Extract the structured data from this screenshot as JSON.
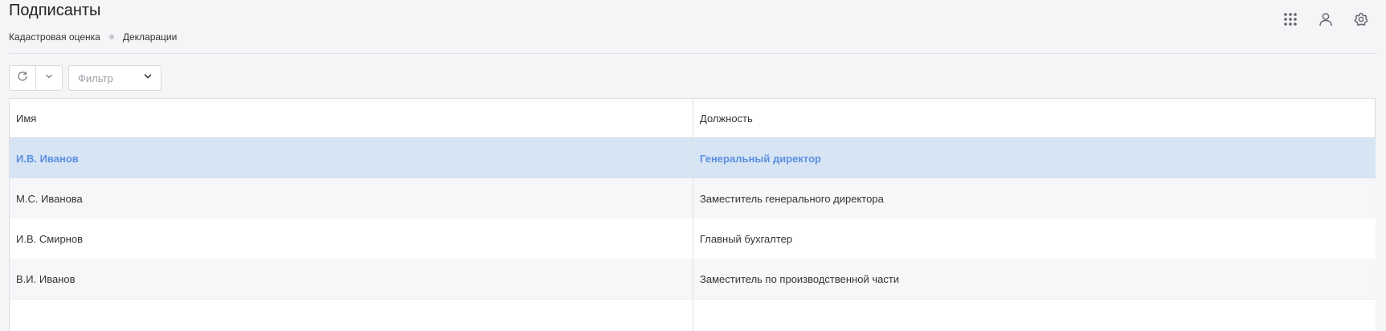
{
  "header": {
    "title": "Подписанты",
    "breadcrumbs": [
      "Кадастровая оценка",
      "Декларации"
    ],
    "icons": [
      "apps-grid-icon",
      "user-icon",
      "settings-gear-icon"
    ]
  },
  "toolbar": {
    "refresh_icon": "refresh-icon",
    "dropdown_icon": "chevron-down-icon",
    "filter_placeholder": "Фильтр"
  },
  "table": {
    "columns": [
      "Имя",
      "Должность"
    ],
    "rows": [
      {
        "name": "И.В. Иванов",
        "position": "Генеральный директор",
        "selected": true
      },
      {
        "name": "М.С. Иванова",
        "position": "Заместитель генерального директора",
        "selected": false
      },
      {
        "name": "И.В. Смирнов",
        "position": "Главный бухгалтер",
        "selected": false
      },
      {
        "name": "В.И. Иванов",
        "position": "Заместитель по производственной части",
        "selected": false
      }
    ]
  },
  "colors": {
    "selected_row_bg": "#d6e4f4",
    "selected_text": "#5b8fe0",
    "page_bg": "#f5f5f7"
  }
}
